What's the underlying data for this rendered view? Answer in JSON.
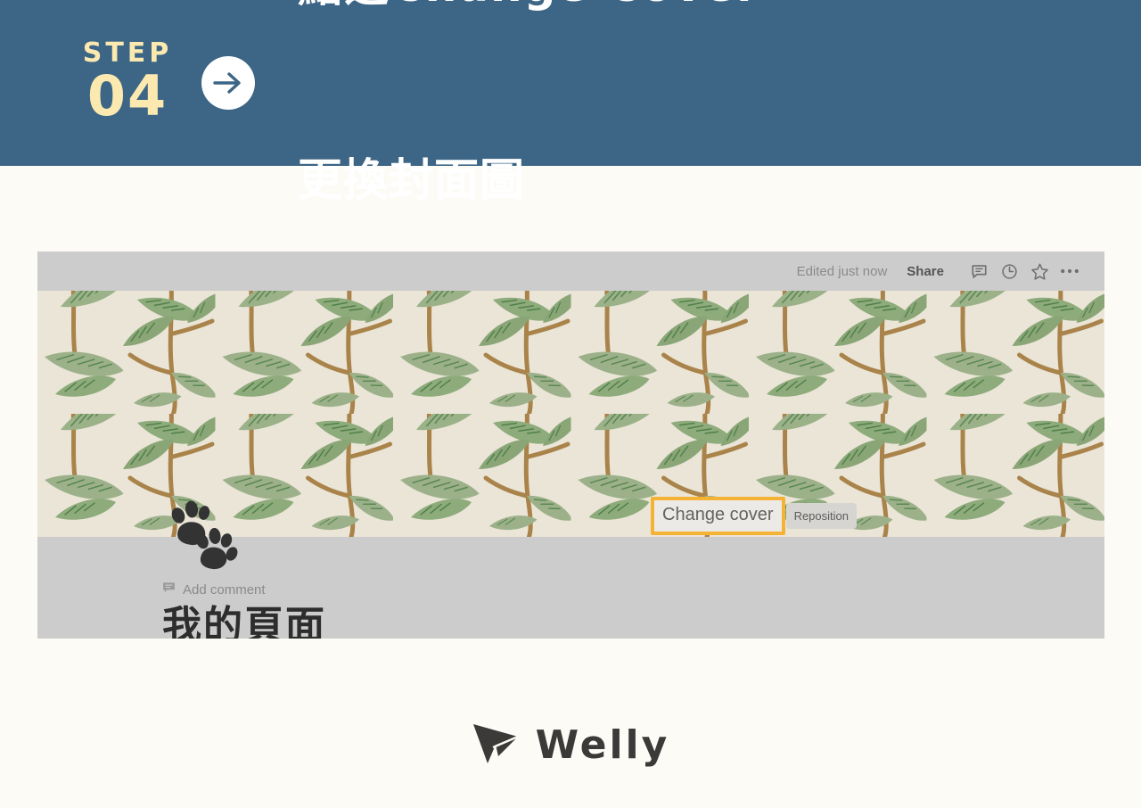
{
  "banner": {
    "step_word": "STEP",
    "step_number": "04",
    "arrow_icon": "arrow-right-icon",
    "heading_line1": "點選Change Cover",
    "heading_line2": "更換封面圖",
    "bg_color": "#3c6586",
    "accent_color": "#fce9b0",
    "text_color": "#ffffff"
  },
  "notion": {
    "topbar": {
      "edited_status": "Edited just now",
      "share_label": "Share",
      "comment_icon": "comment-bubble-icon",
      "history_icon": "clock-history-icon",
      "favorite_icon": "star-icon",
      "more_icon": "ellipsis-icon"
    },
    "cover": {
      "description": "willow-bough-leaf-wallpaper",
      "leaf_color": "#93ab82",
      "leaf_vein_color": "#4e8049",
      "stem_color": "#a98348",
      "background_color": "#e9e4d6",
      "buttons": {
        "change_cover": "Change cover",
        "reposition": "Reposition",
        "highlight_color": "#f5b335"
      }
    },
    "page": {
      "icon": "paw-prints-icon",
      "add_comment": "Add comment",
      "comment_icon": "comment-bubble-icon",
      "title": "我的頁面"
    },
    "panel_color": "#cccccc"
  },
  "footer": {
    "brand": "Welly",
    "logo_icon": "paper-plane-icon",
    "logo_color": "#3b3a38"
  },
  "page_background": "#fdfbf6"
}
